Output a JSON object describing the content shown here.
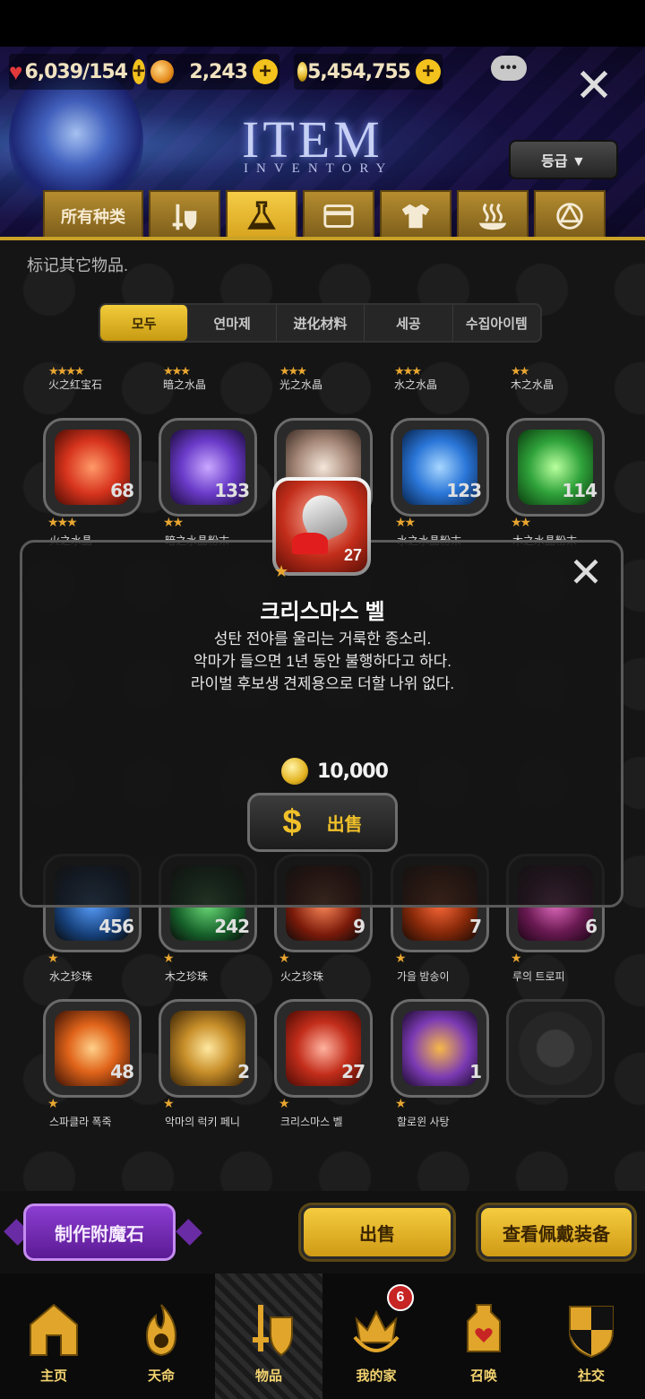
{
  "resources": {
    "stamina": "6,039",
    "stamina_max": "/154",
    "gems": "2,243",
    "gold": "5,454,755"
  },
  "header": {
    "title": "ITEM",
    "subtitle": "INVENTORY",
    "grade_button": "등급 ▼"
  },
  "tabs": [
    {
      "label": "所有种类",
      "icon": "all-icon"
    },
    {
      "label": "",
      "icon": "equipment-icon"
    },
    {
      "label": "",
      "icon": "flask-icon"
    },
    {
      "label": "",
      "icon": "card-icon"
    },
    {
      "label": "",
      "icon": "shirt-icon"
    },
    {
      "label": "",
      "icon": "bath-icon"
    },
    {
      "label": "",
      "icon": "emblem-icon"
    }
  ],
  "hint": "标记其它物品.",
  "filters": [
    "모두",
    "연마제",
    "进化材料",
    "세공",
    "수집아이템"
  ],
  "top_labels": [
    "火之红宝石",
    "暗之水晶",
    "光之水晶",
    "水之水晶",
    "木之水晶"
  ],
  "grid": {
    "row1": [
      {
        "name": "火之水晶",
        "count": "68",
        "stars": "★★★",
        "color": "#d7341d"
      },
      {
        "name": "暗之水晶粉末",
        "count": "133",
        "stars": "★★",
        "color": "#6a3bc9"
      },
      {
        "name": "",
        "count": "",
        "stars": "",
        "color": "#a88a7a"
      },
      {
        "name": "水之水晶粉末",
        "count": "123",
        "stars": "★★",
        "color": "#2a76d8"
      },
      {
        "name": "木之水晶粉末",
        "count": "114",
        "stars": "★★",
        "color": "#2fa23a"
      }
    ],
    "row4": [
      {
        "name": "水之珍珠",
        "count": "456",
        "stars": "★"
      },
      {
        "name": "木之珍珠",
        "count": "242",
        "stars": "★"
      },
      {
        "name": "火之珍珠",
        "count": "9",
        "stars": "★"
      },
      {
        "name": "가을 밤송이",
        "count": "7",
        "stars": "★"
      },
      {
        "name": "루의 트로피",
        "count": "6",
        "stars": "★"
      }
    ],
    "row5": [
      {
        "name": "스파클라 폭죽",
        "count": "48",
        "stars": "★",
        "color": "#e0641a"
      },
      {
        "name": "악마의 럭키 페니",
        "count": "2",
        "stars": "★",
        "color": "#c88f2a"
      },
      {
        "name": "크리스마스 벨",
        "count": "27",
        "stars": "★",
        "color": "#c22d1a"
      },
      {
        "name": "할로윈 사탕",
        "count": "1",
        "stars": "★",
        "color": "#7b3ab3"
      }
    ]
  },
  "popup": {
    "count": "27",
    "name": "크리스마스 벨",
    "desc1": "성탄 전야를 울리는 거룩한 종소리.",
    "desc2": "악마가 들으면 1년 동안 불행하다고 하다.",
    "desc3": "라이벌 후보생 견제용으로 더할 나위 없다.",
    "price": "10,000",
    "sell_icon": "$",
    "sell_label": "出售"
  },
  "actions": {
    "craft": "制作附魔石",
    "sell": "出售",
    "view_equipped": "查看佩戴装备"
  },
  "nav": [
    {
      "label": "主页",
      "icon": "home-icon"
    },
    {
      "label": "天命",
      "icon": "flame-icon"
    },
    {
      "label": "物品",
      "icon": "sword-shield-icon"
    },
    {
      "label": "我的家",
      "icon": "crown-icon",
      "badge": "6"
    },
    {
      "label": "召唤",
      "icon": "potion-icon"
    },
    {
      "label": "社交",
      "icon": "crest-icon"
    }
  ]
}
